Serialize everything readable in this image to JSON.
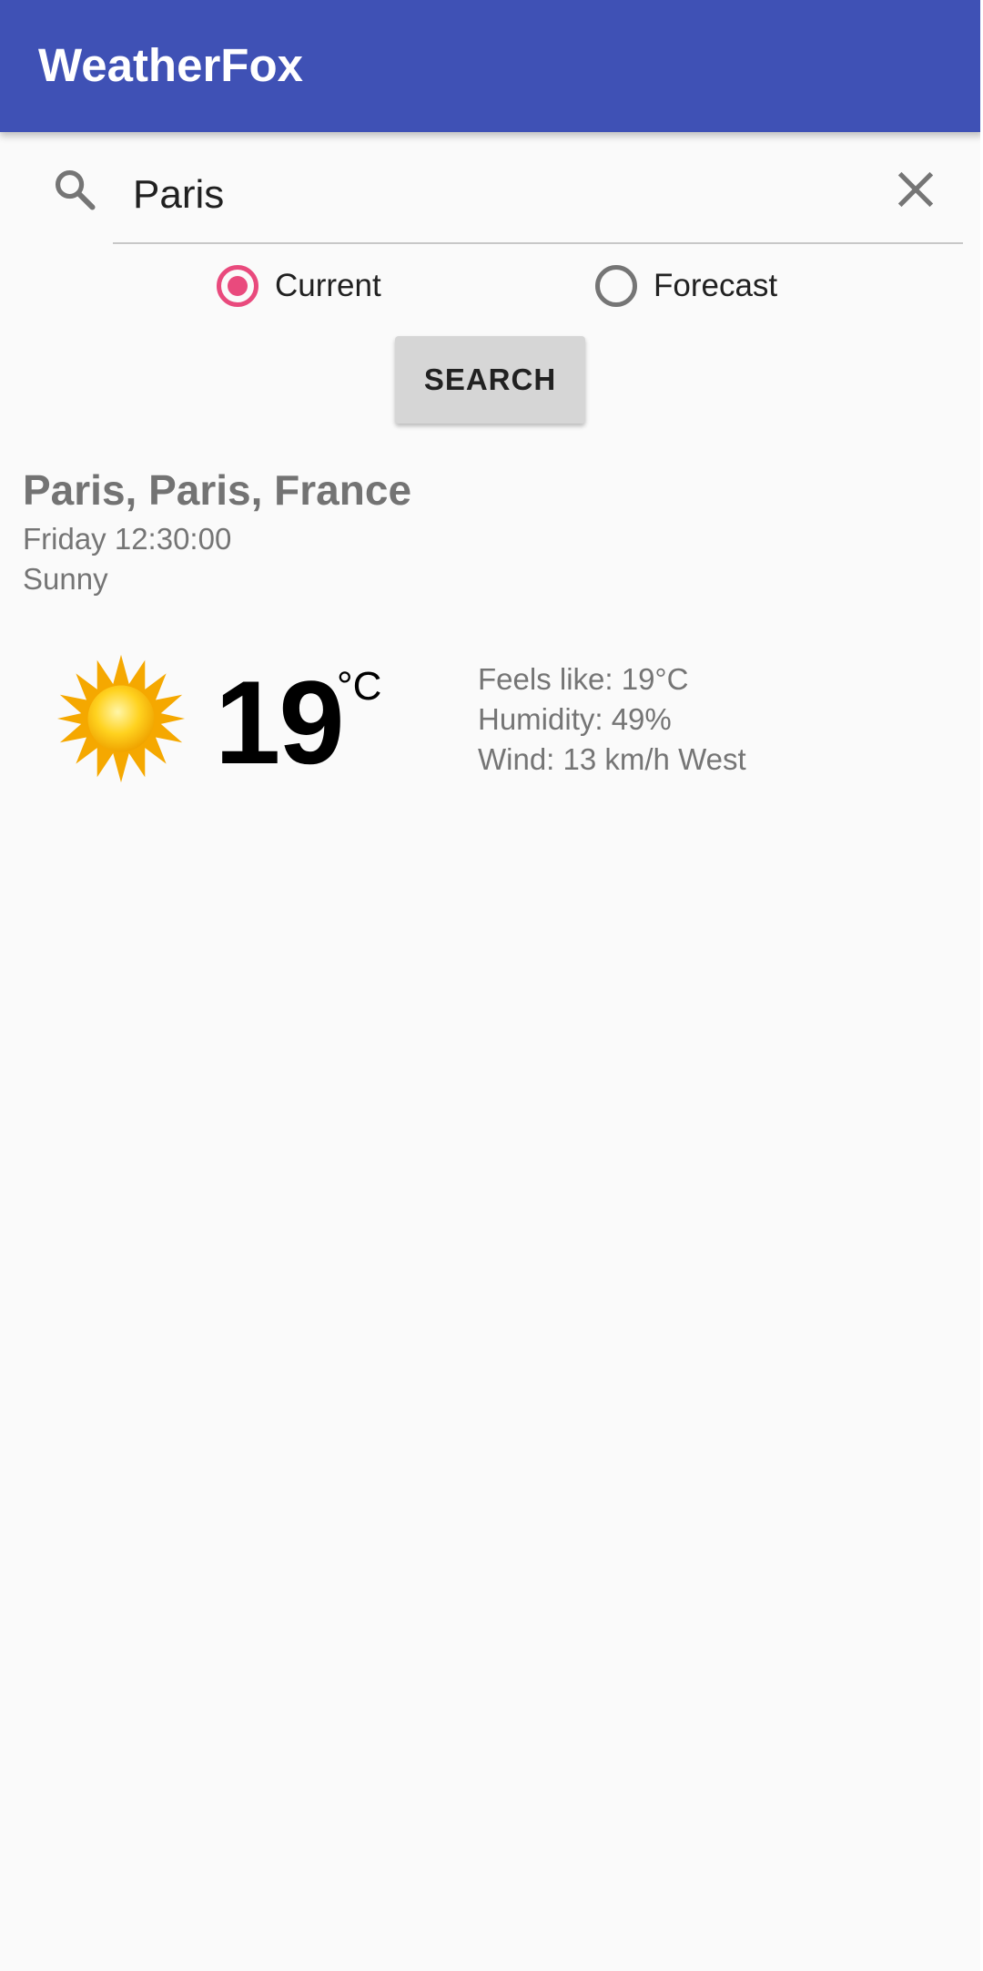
{
  "app": {
    "title": "WeatherFox"
  },
  "search": {
    "value": "Paris",
    "button_label": "SEARCH"
  },
  "mode": {
    "options": [
      {
        "label": "Current",
        "selected": true
      },
      {
        "label": "Forecast",
        "selected": false
      }
    ]
  },
  "weather": {
    "location": "Paris, Paris, France",
    "datetime": "Friday 12:30:00",
    "condition": "Sunny",
    "condition_icon": "sun-icon",
    "temperature": "19",
    "unit": "°C",
    "feels_like": "Feels like: 19°C",
    "humidity": "Humidity: 49%",
    "wind": "Wind: 13 km/h West"
  },
  "colors": {
    "app_bar": "#3f51b5",
    "accent": "#e94a7d",
    "background": "#fafafa",
    "button": "#d6d6d6"
  }
}
